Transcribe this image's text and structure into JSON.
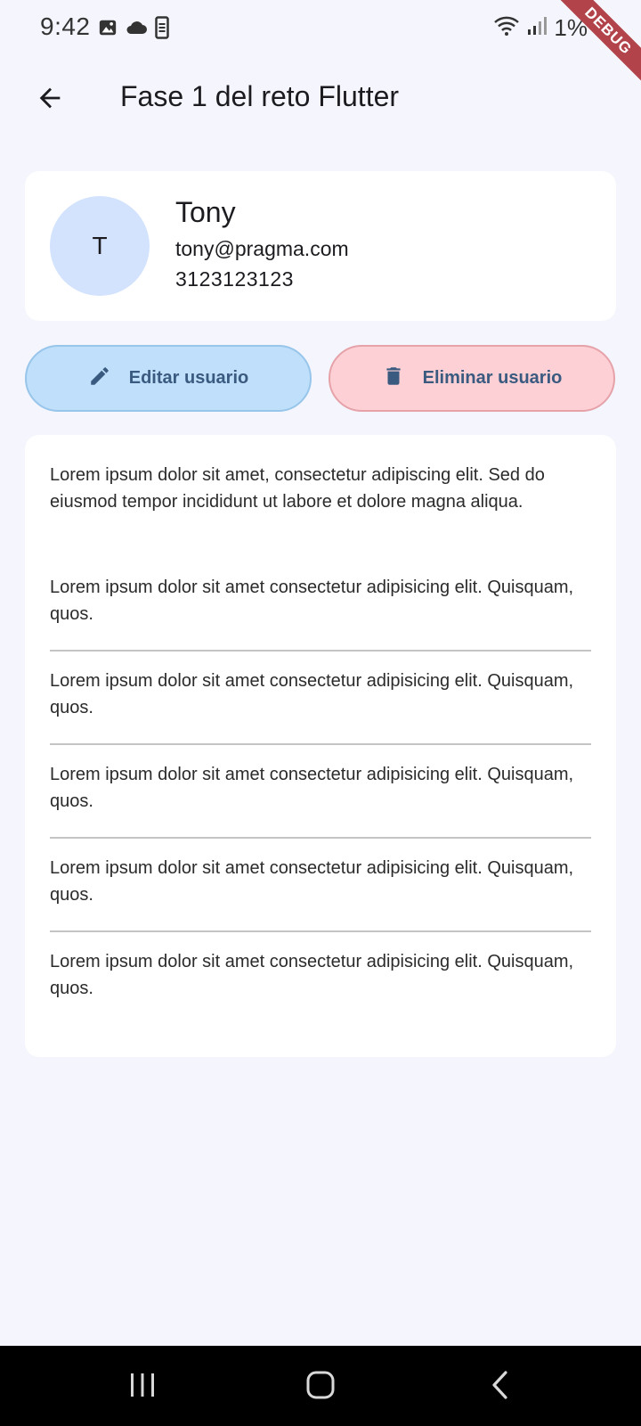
{
  "status_bar": {
    "time": "9:42",
    "battery": "1%",
    "icons_left": [
      "image-icon",
      "cloud-icon",
      "phone-icon"
    ],
    "icons_right": [
      "wifi-icon",
      "signal-icon"
    ]
  },
  "debug_banner": "DEBUG",
  "app_bar": {
    "title": "Fase 1 del reto Flutter",
    "back_icon": "arrow-back-icon"
  },
  "profile": {
    "avatar_initial": "T",
    "name": "Tony",
    "email": "tony@pragma.com",
    "phone": "3123123123"
  },
  "actions": {
    "edit_label": "Editar usuario",
    "delete_label": "Eliminar usuario"
  },
  "content": {
    "intro": "Lorem ipsum dolor sit amet, consectetur adipiscing elit. Sed do eiusmod tempor incididunt ut labore et dolore magna aliqua.",
    "items": [
      "Lorem ipsum dolor sit amet consectetur adipisicing elit. Quisquam, quos.",
      "Lorem ipsum dolor sit amet consectetur adipisicing elit. Quisquam, quos.",
      "Lorem ipsum dolor sit amet consectetur adipisicing elit. Quisquam, quos.",
      "Lorem ipsum dolor sit amet consectetur adipisicing elit. Quisquam, quos.",
      "Lorem ipsum dolor sit amet consectetur adipisicing elit. Quisquam, quos."
    ]
  },
  "colors": {
    "background": "#f5f6fd",
    "card": "#ffffff",
    "avatar": "#d3e3fd",
    "edit_button": "#bfdffa",
    "delete_button": "#fdd0d5",
    "button_text": "#3a5a80",
    "debug_ribbon": "#b2434a"
  },
  "nav_bar": {
    "icons": [
      "recent-apps-icon",
      "home-icon",
      "back-icon"
    ]
  }
}
